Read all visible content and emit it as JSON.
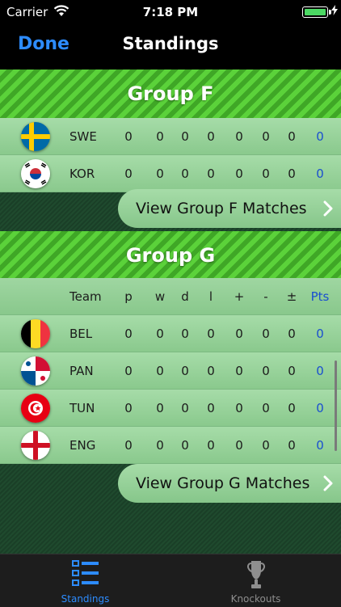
{
  "status": {
    "carrier": "Carrier",
    "time": "7:18 PM"
  },
  "nav": {
    "done_label": "Done",
    "title": "Standings"
  },
  "column_headers": {
    "team": "Team",
    "p": "p",
    "w": "w",
    "d": "d",
    "l": "l",
    "plus": "+",
    "minus": "-",
    "pm": "±",
    "pts": "Pts"
  },
  "groups": [
    {
      "name": "Group F",
      "view_label": "View Group F Matches",
      "rows": [
        {
          "team": "SWE",
          "p": "0",
          "w": "0",
          "d": "0",
          "l": "0",
          "plus": "0",
          "minus": "0",
          "pm": "0",
          "pts": "0"
        },
        {
          "team": "KOR",
          "p": "0",
          "w": "0",
          "d": "0",
          "l": "0",
          "plus": "0",
          "minus": "0",
          "pm": "0",
          "pts": "0"
        }
      ]
    },
    {
      "name": "Group G",
      "view_label": "View Group G Matches",
      "rows": [
        {
          "team": "BEL",
          "p": "0",
          "w": "0",
          "d": "0",
          "l": "0",
          "plus": "0",
          "minus": "0",
          "pm": "0",
          "pts": "0"
        },
        {
          "team": "PAN",
          "p": "0",
          "w": "0",
          "d": "0",
          "l": "0",
          "plus": "0",
          "minus": "0",
          "pm": "0",
          "pts": "0"
        },
        {
          "team": "TUN",
          "p": "0",
          "w": "0",
          "d": "0",
          "l": "0",
          "plus": "0",
          "minus": "0",
          "pm": "0",
          "pts": "0"
        },
        {
          "team": "ENG",
          "p": "0",
          "w": "0",
          "d": "0",
          "l": "0",
          "plus": "0",
          "minus": "0",
          "pm": "0",
          "pts": "0"
        }
      ]
    }
  ],
  "tabs": [
    {
      "label": "Standings",
      "icon": "list-icon",
      "active": true
    },
    {
      "label": "Knockouts",
      "icon": "trophy-icon",
      "active": false
    }
  ],
  "colors": {
    "accent": "#2d8cff",
    "pts": "#1a4fd0",
    "battery": "#4cd964"
  }
}
